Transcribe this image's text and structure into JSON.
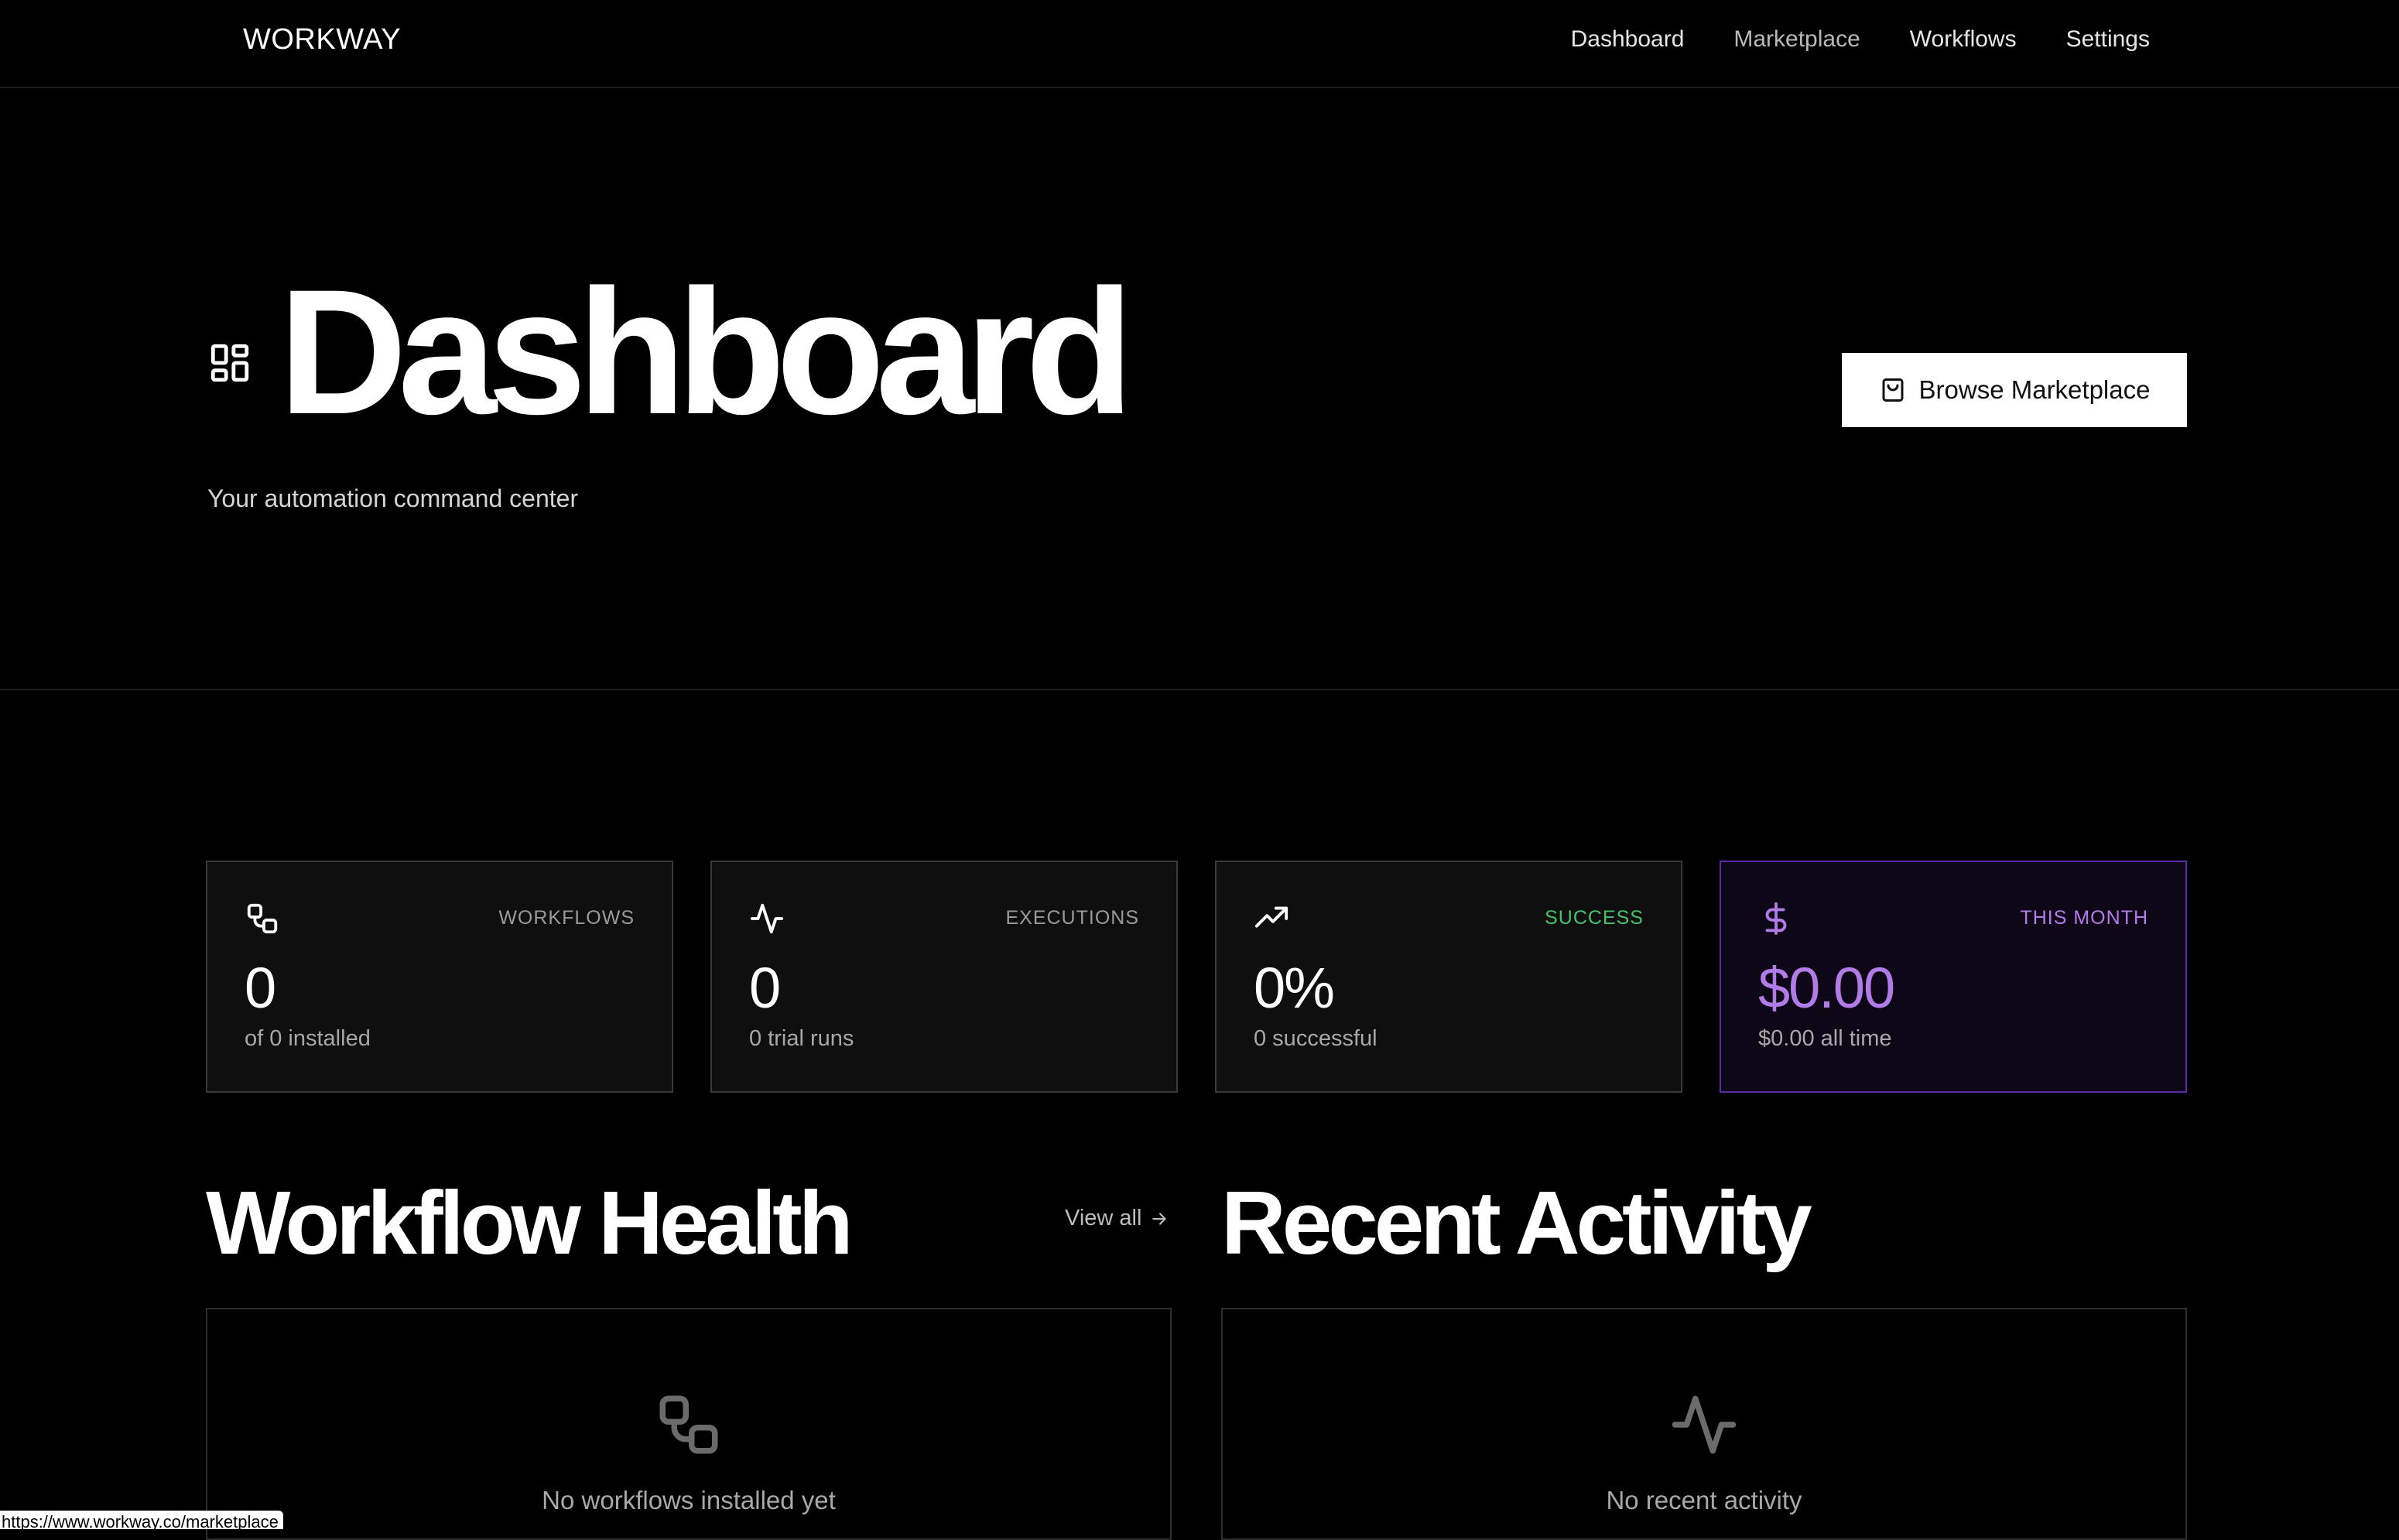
{
  "nav": {
    "logo": "WORKWAY",
    "links": [
      "Dashboard",
      "Marketplace",
      "Workflows",
      "Settings"
    ]
  },
  "hero": {
    "title": "Dashboard",
    "subtitle": "Your automation command center",
    "browse_button": "Browse Marketplace"
  },
  "stats": [
    {
      "label": "WORKFLOWS",
      "value": "0",
      "sub": "of 0 installed",
      "icon": "workflow-icon"
    },
    {
      "label": "EXECUTIONS",
      "value": "0",
      "sub": "0 trial runs",
      "icon": "activity-icon"
    },
    {
      "label": "SUCCESS",
      "value": "0%",
      "sub": "0 successful",
      "icon": "trending-up-icon",
      "label_color": "#46c26a"
    },
    {
      "label": "THIS MONTH",
      "value": "$0.00",
      "sub": "$0.00 all time",
      "icon": "dollar-icon",
      "accent_color": "#b27be8"
    }
  ],
  "workflow_health": {
    "title": "Workflow Health",
    "view_all": "View all",
    "empty_text": "No workflows installed yet"
  },
  "recent_activity": {
    "title": "Recent Activity",
    "empty_text": "No recent activity"
  },
  "status_bar": {
    "url": "https://www.workway.co/marketplace"
  }
}
